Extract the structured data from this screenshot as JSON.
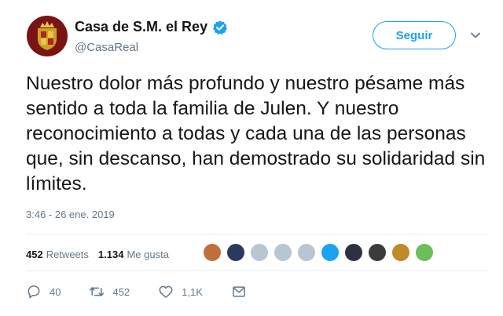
{
  "header": {
    "display_name": "Casa de S.M. el Rey",
    "handle": "@CasaReal",
    "follow_label": "Seguir"
  },
  "tweet": {
    "text": "Nuestro dolor más profundo y nuestro pésame más sentido a toda la familia de Julen. Y nuestro reconocimiento a todas y cada una de las personas que, sin descanso, han demostrado su solidaridad sin límites.",
    "timestamp": "3:46 - 26 ene. 2019"
  },
  "stats": {
    "retweets_count": "452",
    "retweets_label": "Retweets",
    "likes_count": "1.134",
    "likes_label": "Me gusta"
  },
  "liker_avatars": [
    "#c0703a",
    "#2b3a5c",
    "#b8c6d2",
    "#b8c6d2",
    "#b8c6d2",
    "#1da1f2",
    "#2d3142",
    "#3b3b3b",
    "#c08a2a",
    "#6bbf59"
  ],
  "actions": {
    "reply_count": "40",
    "retweet_count": "452",
    "like_count": "1,1K"
  },
  "colors": {
    "accent": "#1da1f2",
    "muted": "#657786",
    "text": "#14171a",
    "avatar_bg": "#7a1414"
  },
  "icons": [
    "verified-badge-icon",
    "caret-down-icon",
    "reply-icon",
    "retweet-icon",
    "heart-icon",
    "envelope-icon",
    "royal-crest-icon"
  ]
}
